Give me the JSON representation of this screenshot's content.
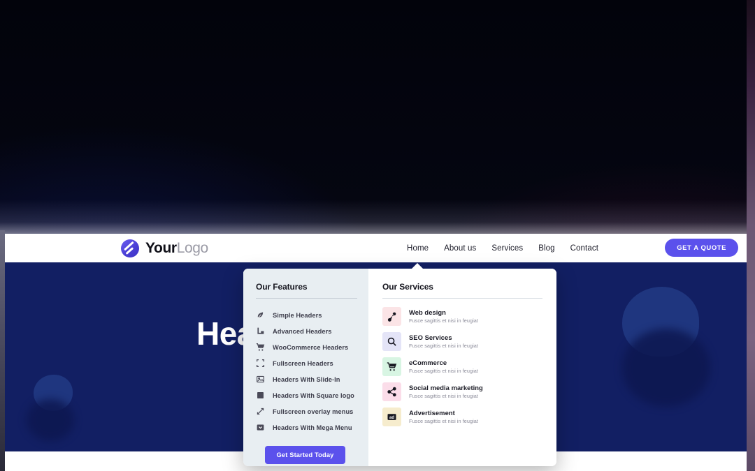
{
  "header": {
    "logo": {
      "bold": "Your",
      "light": "Logo",
      "icon": "logo-swirl-icon"
    },
    "nav": [
      {
        "label": "Home"
      },
      {
        "label": "About us"
      },
      {
        "label": "Services"
      },
      {
        "label": "Blog"
      },
      {
        "label": "Contact"
      }
    ],
    "cta": "GET A QUOTE"
  },
  "hero": {
    "heading": "Hea"
  },
  "mega_menu": {
    "features": {
      "title": "Our Features",
      "items": [
        {
          "label": "Simple Headers",
          "icon": "leaf-icon"
        },
        {
          "label": "Advanced Headers",
          "icon": "corner-bottom-left-icon"
        },
        {
          "label": "WooCommerce Headers",
          "icon": "shopping-cart-icon"
        },
        {
          "label": "Fullscreen Headers",
          "icon": "fullscreen-corners-icon"
        },
        {
          "label": "Headers With Slide-In",
          "icon": "image-icon"
        },
        {
          "label": "Headers With Square logo",
          "icon": "filled-square-icon"
        },
        {
          "label": "Fullscreen overlay menus",
          "icon": "diagonal-arrows-icon"
        },
        {
          "label": "Headers With Mega Menu",
          "icon": "dropdown-box-icon"
        }
      ],
      "cta": "Get Started Today"
    },
    "services": {
      "title": "Our Services",
      "items": [
        {
          "title": "Web design",
          "desc": "Fusce sagittis et nisi in feugiat",
          "icon": "pen-nib-icon",
          "tile_color": "#fbe4e6"
        },
        {
          "title": "SEO Services",
          "desc": "Fusce sagittis et nisi in feugiat",
          "icon": "magnifier-icon",
          "tile_color": "#e4e4f7"
        },
        {
          "title": "eCommerce",
          "desc": "Fusce sagittis et nisi in feugiat",
          "icon": "shopping-cart-icon",
          "tile_color": "#d8f5e3"
        },
        {
          "title": "Social media marketing",
          "desc": "Fusce sagittis et nisi in feugiat",
          "icon": "share-nodes-icon",
          "tile_color": "#fbdde9"
        },
        {
          "title": "Advertisement",
          "desc": "Fusce sagittis et nisi in feugiat",
          "icon": "ad-badge-icon",
          "tile_color": "#f6eccd"
        }
      ]
    }
  },
  "colors": {
    "accent_purple": "#5b51ec",
    "hero_navy": "#121f63",
    "features_panel": "#e8eef2",
    "nav_text": "#1b1b28"
  }
}
